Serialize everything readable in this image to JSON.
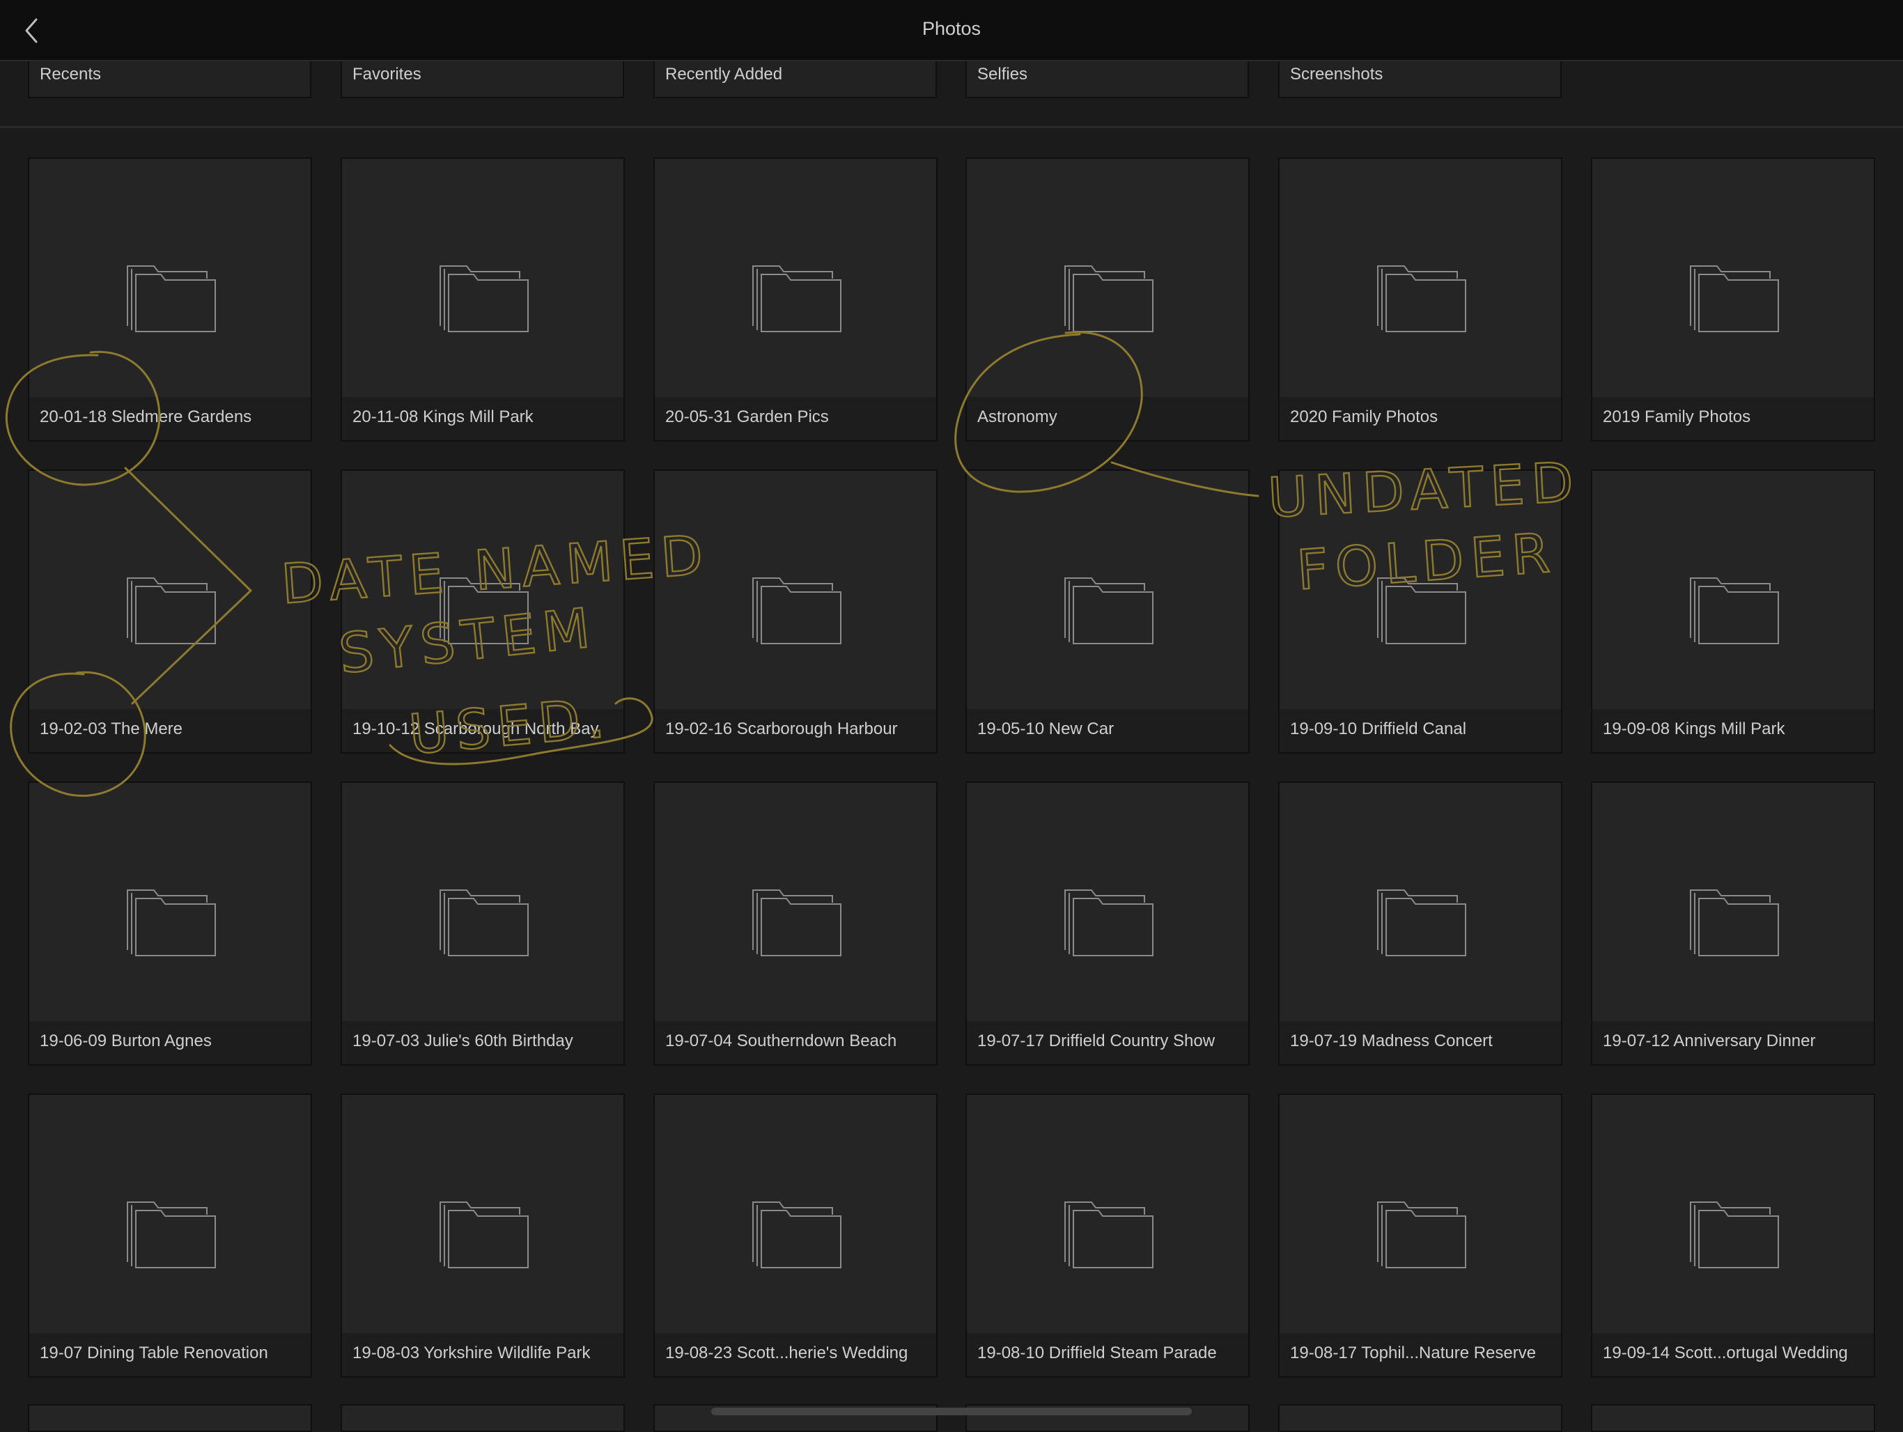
{
  "header": {
    "title": "Photos",
    "back_icon": "chevron-left-icon"
  },
  "albums": [
    {
      "label": "Recents"
    },
    {
      "label": "Favorites"
    },
    {
      "label": "Recently Added"
    },
    {
      "label": "Selfies"
    },
    {
      "label": "Screenshots"
    }
  ],
  "folders": [
    {
      "label": "20-01-18 Sledmere Gardens"
    },
    {
      "label": "20-11-08 Kings Mill Park"
    },
    {
      "label": "20-05-31 Garden Pics"
    },
    {
      "label": "Astronomy"
    },
    {
      "label": "2020 Family Photos"
    },
    {
      "label": "2019 Family Photos"
    },
    {
      "label": "19-02-03 The Mere"
    },
    {
      "label": "19-10-12 Scarborough North Bay"
    },
    {
      "label": "19-02-16 Scarborough Harbour"
    },
    {
      "label": "19-05-10 New Car"
    },
    {
      "label": "19-09-10 Driffield Canal"
    },
    {
      "label": "19-09-08 Kings Mill Park"
    },
    {
      "label": "19-06-09 Burton Agnes"
    },
    {
      "label": "19-07-03 Julie's 60th Birthday"
    },
    {
      "label": "19-07-04 Southerndown Beach"
    },
    {
      "label": "19-07-17 Driffield Country Show"
    },
    {
      "label": "19-07-19 Madness Concert"
    },
    {
      "label": "19-07-12 Anniversary Dinner"
    },
    {
      "label": "19-07 Dining Table Renovation"
    },
    {
      "label": "19-08-03 Yorkshire Wildlife Park"
    },
    {
      "label": "19-08-23 Scott...herie's Wedding"
    },
    {
      "label": "19-08-10 Driffield Steam Parade"
    },
    {
      "label": "19-08-17 Tophil...Nature Reserve"
    },
    {
      "label": "19-09-14 Scott...ortugal Wedding"
    }
  ],
  "annotations": {
    "color": "#8d7a2e",
    "left_note": [
      "DATE NAMED",
      "SYSTEM",
      "USED."
    ],
    "right_note": [
      "UNDATED",
      "FOLDER"
    ]
  }
}
